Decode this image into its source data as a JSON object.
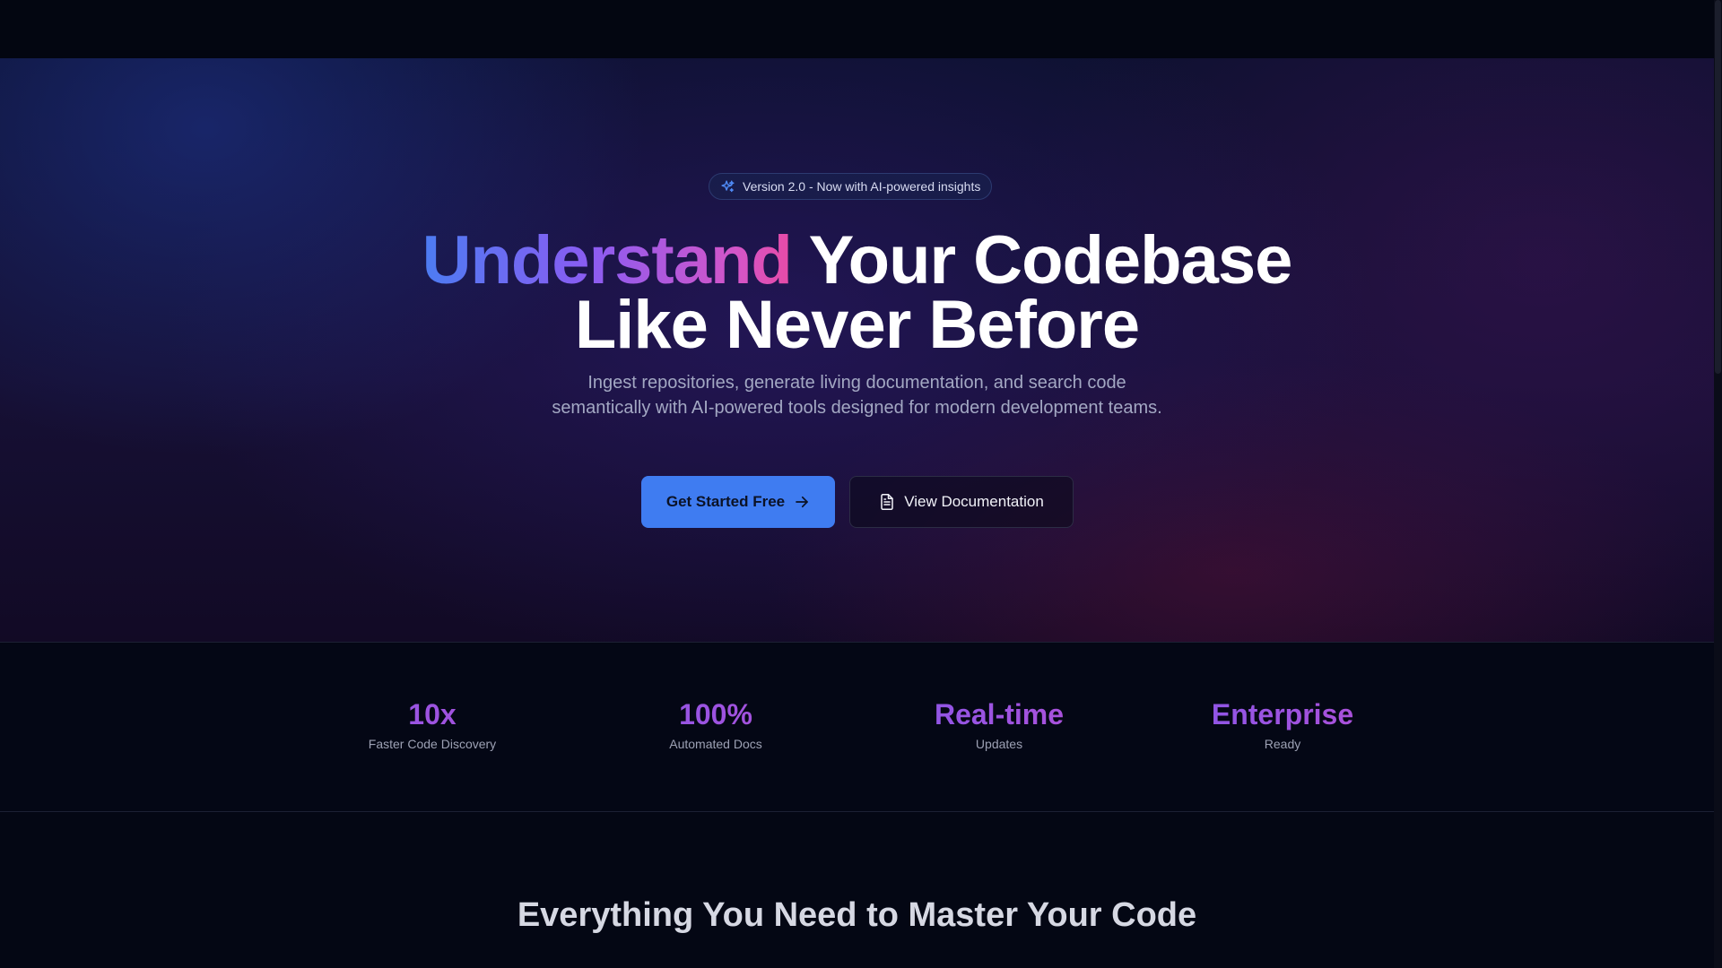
{
  "hero": {
    "badge_text": "Version 2.0 - Now with AI-powered insights",
    "headline_highlight": "Understand",
    "headline_rest_line1": "Your Codebase",
    "headline_line2": "Like Never Before",
    "subtext": "Ingest repositories, generate living documentation, and search code semantically with AI-powered tools designed for modern development teams.",
    "primary_button": "Get Started Free",
    "secondary_button": "View Documentation"
  },
  "stats": [
    {
      "value": "10x",
      "label": "Faster Code Discovery"
    },
    {
      "value": "100%",
      "label": "Automated Docs"
    },
    {
      "value": "Real-time",
      "label": "Updates"
    },
    {
      "value": "Enterprise",
      "label": "Ready"
    }
  ],
  "features": {
    "title": "Everything You Need to Master Your Code"
  },
  "icons": {
    "badge": "sparkles-icon",
    "primary_button": "arrow-right-icon",
    "secondary_button": "document-icon"
  },
  "colors": {
    "background": "#040714",
    "primary": "#3f7cf1",
    "gradient_start": "#4c7cf2",
    "gradient_end": "#e64ba6"
  }
}
